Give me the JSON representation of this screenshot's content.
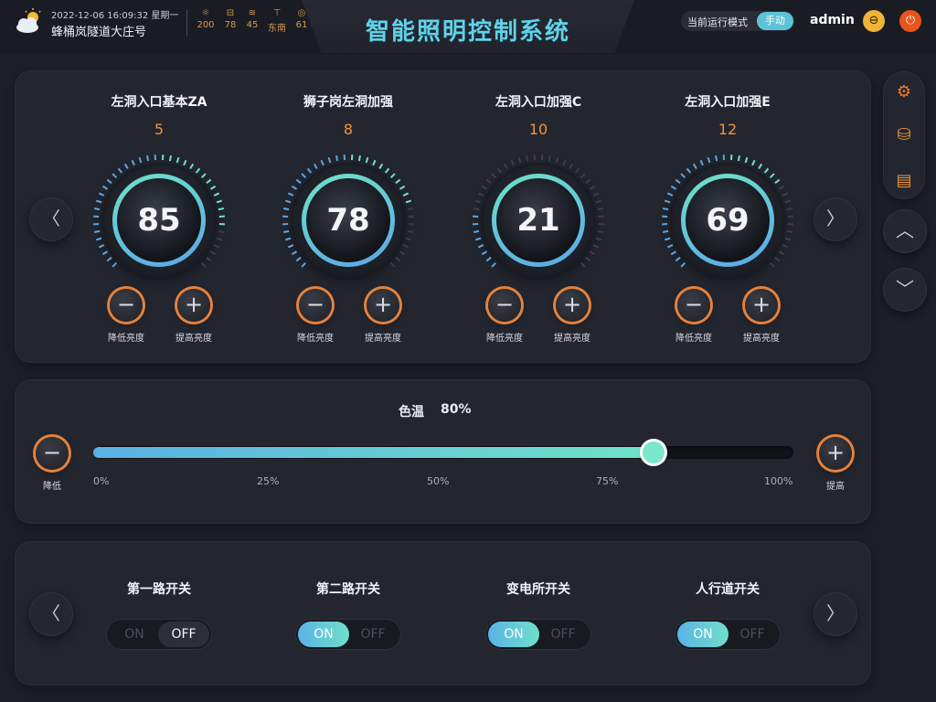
{
  "header": {
    "datetime": "2022-12-06 16:09:32 星期一",
    "location": "蜂桶岚隧道大庄号",
    "title": "智能照明控制系统",
    "env": [
      {
        "icon": "sun-icon",
        "glyph": "☼",
        "value": "200"
      },
      {
        "icon": "car-icon",
        "glyph": "⊟",
        "value": "78"
      },
      {
        "icon": "humidity-icon",
        "glyph": "≋",
        "value": "45"
      },
      {
        "icon": "wind-direction-icon",
        "glyph": "⊤",
        "value": "东南"
      },
      {
        "icon": "gauge-icon",
        "glyph": "◎",
        "value": "61"
      }
    ],
    "mode_label": "当前运行模式",
    "mode_value": "手动",
    "user": "admin"
  },
  "lamps": [
    {
      "name": "左洞入口基本ZA",
      "num": "5",
      "value": 85
    },
    {
      "name": "狮子岗左洞加强",
      "num": "8",
      "value": 78
    },
    {
      "name": "左洞入口加强C",
      "num": "10",
      "value": 21
    },
    {
      "name": "左洞入口加强E",
      "num": "12",
      "value": 69
    }
  ],
  "lamp_btns": {
    "decrease": "降低亮度",
    "increase": "提高亮度"
  },
  "color_temp": {
    "label": "色温",
    "value_text": "80%",
    "value": 0.8,
    "decrease": "降低",
    "increase": "提高",
    "axis": [
      "0%",
      "25%",
      "50%",
      "75%",
      "100%"
    ]
  },
  "switches": [
    {
      "name": "第一路开关",
      "state": "OFF"
    },
    {
      "name": "第二路开关",
      "state": "ON"
    },
    {
      "name": "变电所开关",
      "state": "ON"
    },
    {
      "name": "人行道开关",
      "state": "ON"
    }
  ],
  "toggle_labels": {
    "on": "ON",
    "off": "OFF"
  },
  "colors": {
    "accent_teal": "#6fe3c8",
    "accent_blue": "#5aa6e8",
    "accent_orange": "#f0943a",
    "title_cyan": "#5fd2ea"
  }
}
